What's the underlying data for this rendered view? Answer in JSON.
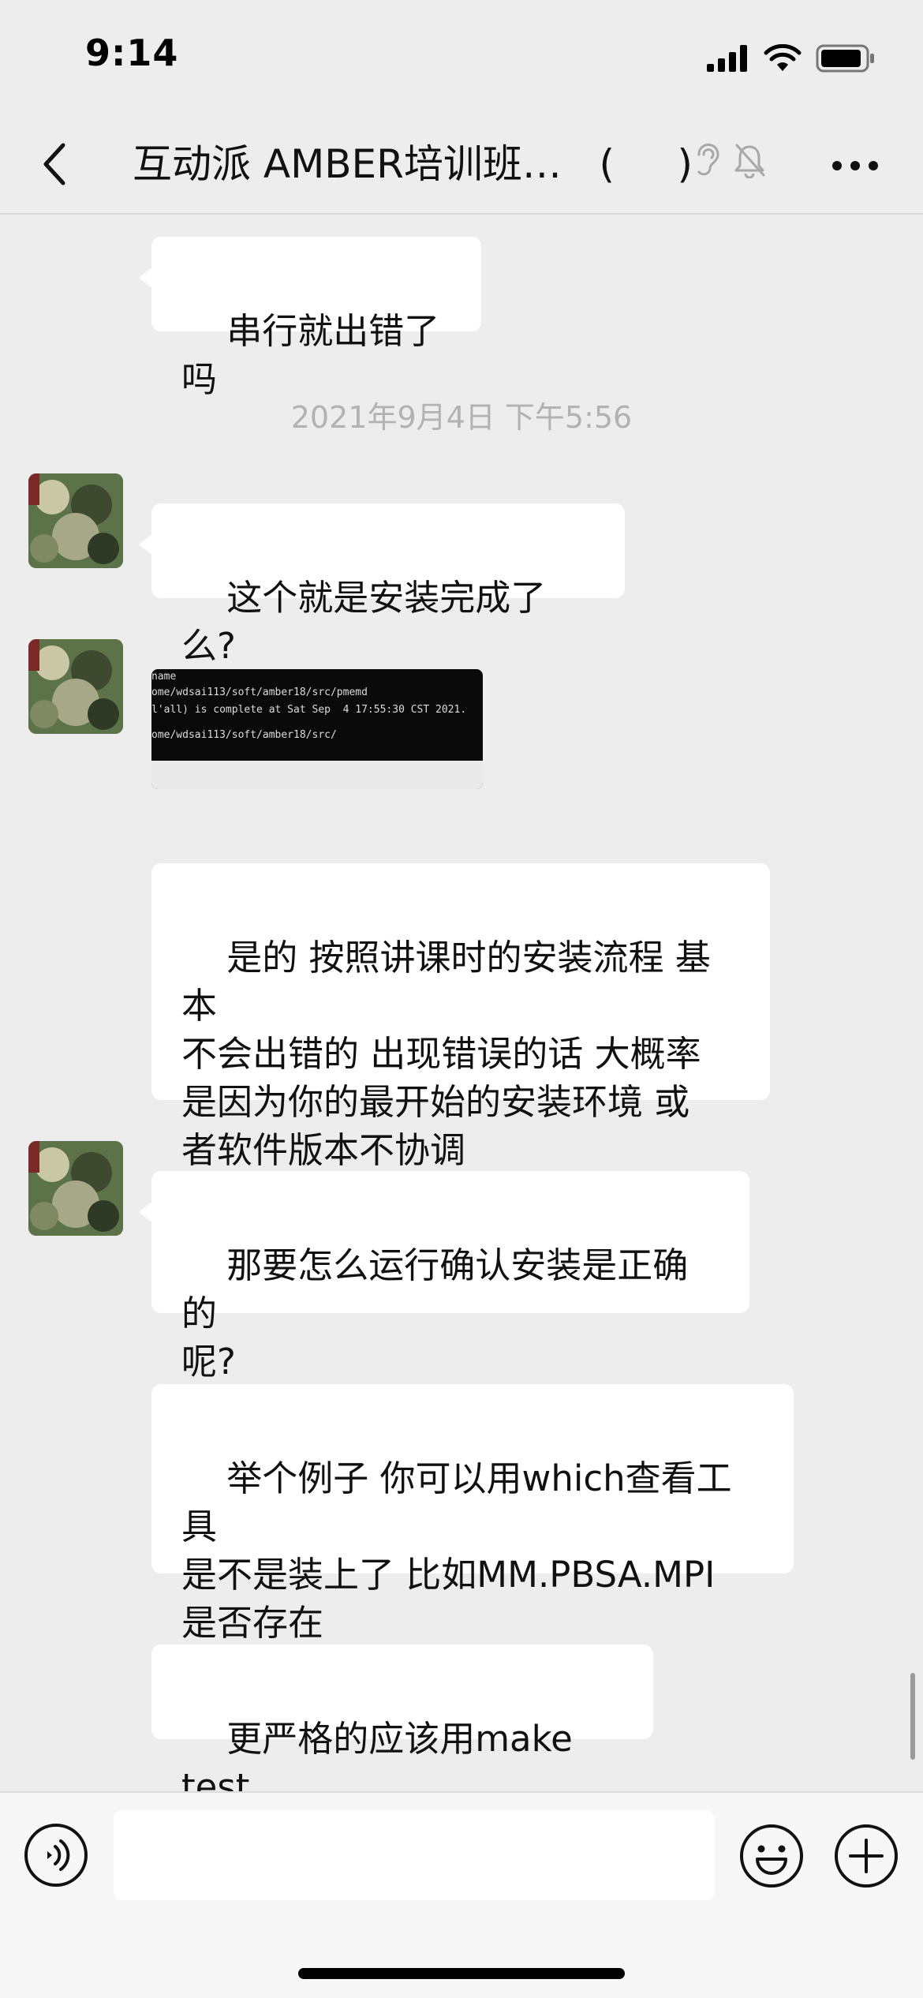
{
  "status_bar": {
    "time": "9:14"
  },
  "header": {
    "title": "互动派 AMBER培训班…   (     )",
    "icons": [
      "back-icon",
      "earpiece-icon",
      "mute-bell-icon",
      "more-icon"
    ]
  },
  "messages": {
    "m1": {
      "text": "串行就出错了吗"
    },
    "timestamp": "2021年9月4日 下午5:56",
    "m2": {
      "text": "这个就是安装完成了么?"
    },
    "m3_image": {
      "lines": [
        "name",
        "ome/wdsai113/soft/amber18/src/pmemd",
        "l'all) is complete at Sat Sep  4 17:55:30 CST 2021.",
        "ome/wdsai113/soft/amber18/src/"
      ]
    },
    "m4": {
      "text": "是的 按照讲课时的安装流程 基本\n不会出错的 出现错误的话 大概率\n是因为你的最开始的安装环境 或\n者软件版本不协调"
    },
    "m5": {
      "text": "那要怎么运行确认安装是正确的\n呢?"
    },
    "m6": {
      "text": "举个例子 你可以用which查看工具\n是不是装上了 比如MM.PBSA.MPI\n是否存在"
    },
    "m7": {
      "text": "更严格的应该用make test"
    }
  },
  "input_bar": {
    "placeholder": "",
    "icons": [
      "voice-icon",
      "emoji-icon",
      "plus-icon"
    ]
  },
  "colors": {
    "background": "#ededed",
    "bubble": "#ffffff",
    "timestamp": "#b2b2b2"
  }
}
